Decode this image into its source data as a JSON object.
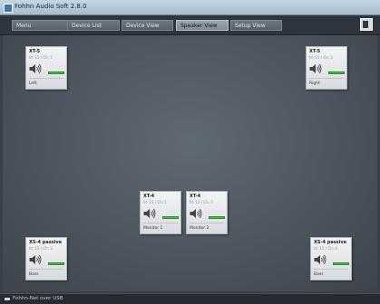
{
  "window": {
    "title": "Fohhn Audio Soft 2.8.0",
    "app_icon": "fohhn-app-icon"
  },
  "nav": {
    "tabs": [
      {
        "label": "Menu",
        "active": false
      },
      {
        "label": "Device List",
        "active": false
      },
      {
        "label": "Device View",
        "active": false
      },
      {
        "label": "Speaker View",
        "active": true
      },
      {
        "label": "Setup View",
        "active": false
      }
    ],
    "corner_button_icon": "view-toggle-icon"
  },
  "speakers": [
    {
      "model": "XT-5",
      "address": "Id: 11 / Ch: 1",
      "name": "Left",
      "icon": "speaker-volume-icon",
      "level_color": "#48c04a"
    },
    {
      "model": "XT-5",
      "address": "Id: 11 / Ch: 2",
      "name": "Right",
      "icon": "speaker-volume-icon",
      "level_color": "#48c04a"
    },
    {
      "model": "XT-4",
      "address": "Id: 13 / Ch: 1",
      "name": "Monitor 1",
      "icon": "speaker-volume-icon",
      "level_color": "#48c04a"
    },
    {
      "model": "XT-4",
      "address": "Id: 13 / Ch: 2",
      "name": "Monitor 2",
      "icon": "speaker-volume-icon",
      "level_color": "#48c04a"
    },
    {
      "model": "XS-4 passive",
      "address": "Id: 15 / Ch: 3",
      "name": "Bass",
      "icon": "speaker-volume-icon",
      "level_color": "#48c04a"
    },
    {
      "model": "XS-4 passive",
      "address": "Id: 15 / Ch: 4",
      "name": "Bass",
      "icon": "speaker-volume-icon",
      "level_color": "#48c04a"
    }
  ],
  "status": {
    "text": "Fohhn-Net over USB"
  },
  "colors": {
    "background": "#39404a",
    "active_tab": "#9aa6b0",
    "level_meter": "#48c04a"
  }
}
